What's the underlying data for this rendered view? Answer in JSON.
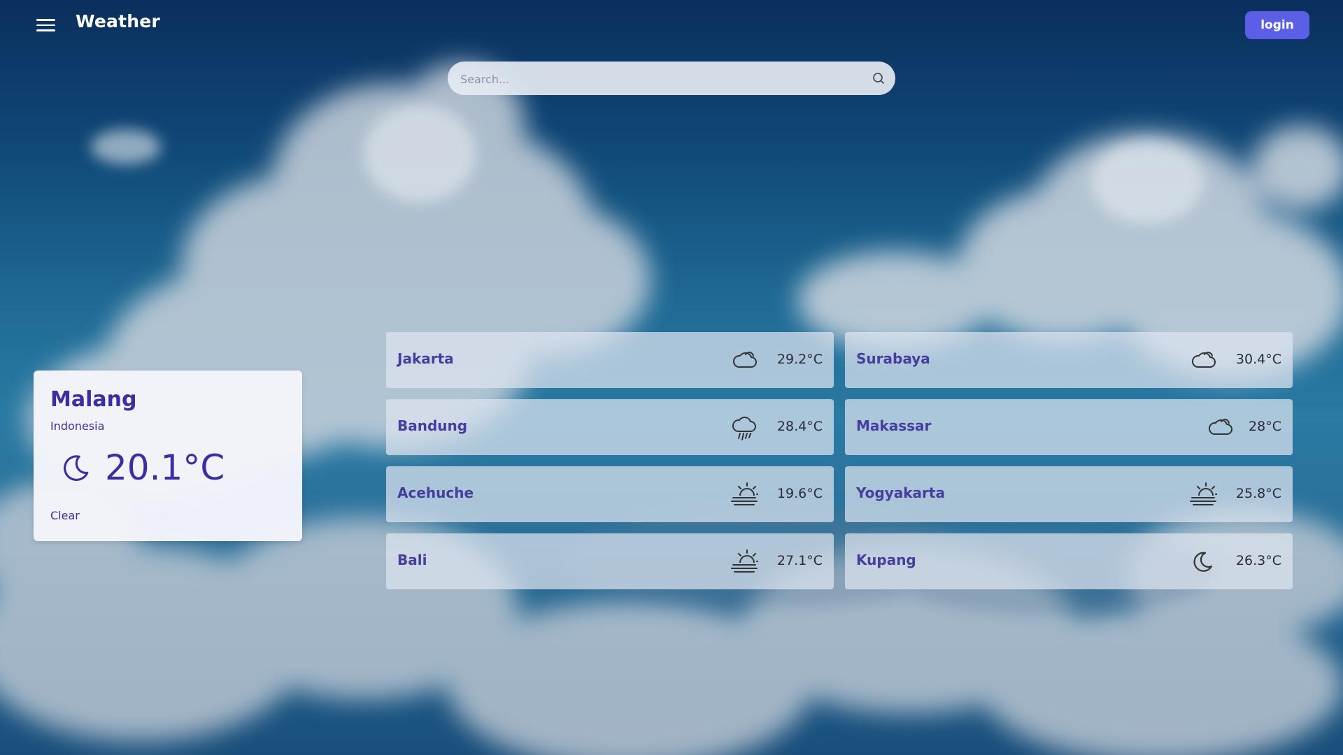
{
  "header": {
    "title": "Weather",
    "menu_icon": "hamburger-menu-icon",
    "login_label": "login"
  },
  "search": {
    "placeholder": "Search...",
    "value": "",
    "icon": "search-icon"
  },
  "current": {
    "city": "Malang",
    "country": "Indonesia",
    "temperature": "20.1°C",
    "condition": "Clear",
    "icon": "moon-icon"
  },
  "cities": [
    {
      "name": "Jakarta",
      "temperature": "29.2°C",
      "icon": "cloud-icon"
    },
    {
      "name": "Surabaya",
      "temperature": "30.4°C",
      "icon": "cloud-icon"
    },
    {
      "name": "Bandung",
      "temperature": "28.4°C",
      "icon": "cloud-rain-icon"
    },
    {
      "name": "Makassar",
      "temperature": "28°C",
      "icon": "cloud-icon"
    },
    {
      "name": "Acehuche",
      "temperature": "19.6°C",
      "icon": "sun-haze-icon"
    },
    {
      "name": "Yogyakarta",
      "temperature": "25.8°C",
      "icon": "sun-haze-icon"
    },
    {
      "name": "Bali",
      "temperature": "27.1°C",
      "icon": "sun-haze-icon"
    },
    {
      "name": "Kupang",
      "temperature": "26.3°C",
      "icon": "moon-icon"
    }
  ],
  "colors": {
    "accent": "#5a5fe6",
    "city_text": "#473d9e",
    "main_text": "#3a2fa0"
  }
}
